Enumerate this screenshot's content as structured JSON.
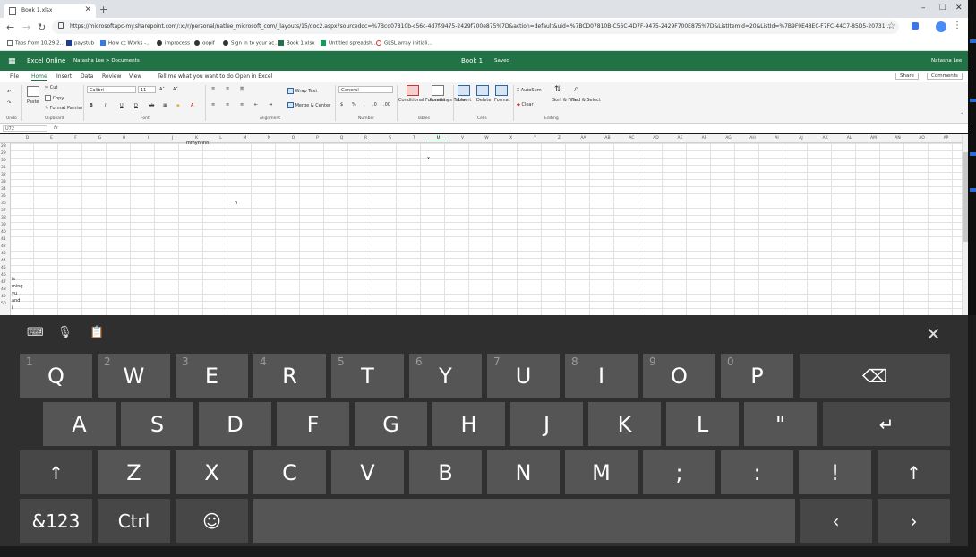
{
  "browser": {
    "tab_title": "Book 1.xlsx",
    "url": "https://microsoftapc-my.sharepoint.com/:x:/r/personal/natlee_microsoft_com/_layouts/15/doc2.aspx?sourcedoc=%7Bcd07810b-c56c-4d7f-9475-2429f700e875%7D&action=default&uid=%7BCD07810B-C56C-4D7F-9475-2429F700E875%7D&ListItemId=20&ListId=%7B9F9E48E0-F7FC-44C7-85D5-20731...",
    "bookmarks": [
      "Tabs from 10.29.2...",
      "paystub",
      "How cc Works -...",
      "improcess",
      "oopif",
      "Sign in to your ac...",
      "Book 1.xlsx",
      "Untitled spreadsh...",
      "GLSL array initiali..."
    ]
  },
  "excel": {
    "brand": "Excel Online",
    "path": "Natasha Lee > Documents",
    "title": "Book 1",
    "saved": "Saved",
    "user": "Natasha Lee",
    "menu": [
      "File",
      "Home",
      "Insert",
      "Data",
      "Review",
      "View",
      "Tell me what you want to do",
      "Open in Excel"
    ],
    "share": "Share",
    "comments": "Comments",
    "ribbon": {
      "paste": "Paste",
      "cut": "Cut",
      "copy": "Copy",
      "format_painter": "Format Painter",
      "font_name": "Calibri",
      "font_size": "11",
      "wrap_text": "Wrap Text",
      "merge_center": "Merge & Center",
      "number_format": "General",
      "conditional_formatting": "Conditional Formatting",
      "format_as_table": "Format as Table",
      "insert": "Insert",
      "delete": "Delete",
      "format": "Format",
      "autosum": "AutoSum",
      "clear": "Clear",
      "sort_filter": "Sort & Filter",
      "find_select": "Find & Select",
      "groups": [
        "Undo",
        "Clipboard",
        "Font",
        "Alignment",
        "Number",
        "Tables",
        "Cells",
        "Editing"
      ]
    },
    "name_box": "U72",
    "fx": "fx",
    "columns": [
      "D",
      "E",
      "F",
      "G",
      "H",
      "I",
      "J",
      "K",
      "L",
      "M",
      "N",
      "O",
      "P",
      "Q",
      "R",
      "S",
      "T",
      "U",
      "V",
      "W",
      "X",
      "Y",
      "Z",
      "AA",
      "AB",
      "AC",
      "AD",
      "AE",
      "AF",
      "AG",
      "AH",
      "AI",
      "AJ",
      "AK",
      "AL",
      "AM",
      "AN",
      "AO",
      "AP"
    ],
    "rows": [
      "28",
      "29",
      "30",
      "31",
      "32",
      "33",
      "34",
      "35",
      "36",
      "37",
      "38",
      "39",
      "40",
      "41",
      "42",
      "43",
      "44",
      "45",
      "46",
      "47",
      "48",
      "49",
      "50"
    ],
    "cells": {
      "k28": "mmynnnn",
      "u30": "x",
      "m36": "h",
      "d46": "is",
      "d47": "ming",
      "d48": "yu",
      "d49": "and",
      "d50": "i"
    }
  },
  "keyboard": {
    "row1": [
      {
        "k": "Q",
        "n": "1"
      },
      {
        "k": "W",
        "n": "2"
      },
      {
        "k": "E",
        "n": "3"
      },
      {
        "k": "R",
        "n": "4"
      },
      {
        "k": "T",
        "n": "5"
      },
      {
        "k": "Y",
        "n": "6"
      },
      {
        "k": "U",
        "n": "7"
      },
      {
        "k": "I",
        "n": "8"
      },
      {
        "k": "O",
        "n": "9"
      },
      {
        "k": "P",
        "n": "0"
      }
    ],
    "row2": [
      "A",
      "S",
      "D",
      "F",
      "G",
      "H",
      "J",
      "K",
      "L",
      "\""
    ],
    "row3": [
      "Z",
      "X",
      "C",
      "V",
      "B",
      "N",
      "M",
      ";",
      ":",
      "!"
    ],
    "backspace": "⌫",
    "enter": "↵",
    "shift": "↑",
    "symbols": "&123",
    "ctrl": "Ctrl",
    "emoji": "☺",
    "left": "‹",
    "right": "›",
    "close": "✕"
  },
  "colors": {
    "excel_green": "#217346",
    "key": "#555555",
    "keyboard_bg": "#2f2f2f"
  }
}
